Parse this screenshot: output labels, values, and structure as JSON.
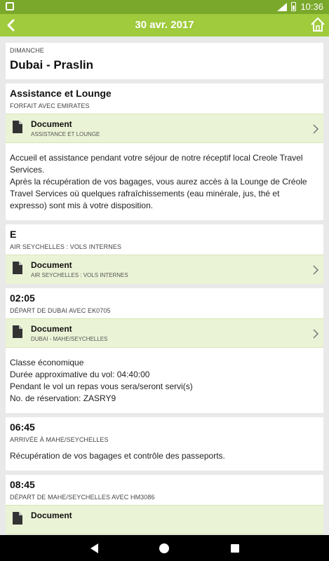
{
  "status_bar": {
    "time": "10:36",
    "signal": "4G",
    "battery": "charging"
  },
  "app_bar": {
    "title": "30 avr. 2017",
    "back_icon": "chevron-left-icon",
    "home_icon": "home-icon"
  },
  "day_card": {
    "day_label": "DIMANCHE",
    "route": "Dubai - Praslin"
  },
  "sections": [
    {
      "title": "Assistance et Lounge",
      "subtitle": "FORFAIT AVEC EMIRATES",
      "document": {
        "title": "Document",
        "subtitle": "ASSISTANCE ET LOUNGE"
      },
      "lines": [
        "Accueil et assistance pendant votre séjour de notre réceptif local Creole Travel",
        "Services.",
        "Après la récupération de vos bagages, vous aurez accès à la Lounge de Créole",
        "Travel Services où quelques rafraîchissements (eau minérale, jus, thé et",
        "expresso) sont mis à votre disposition."
      ]
    },
    {
      "title": "E",
      "subtitle": "AIR SEYCHELLES : VOLS INTERNES",
      "document": {
        "title": "Document",
        "subtitle": "AIR SEYCHELLES : VOLS INTERNES"
      },
      "lines": []
    },
    {
      "title": "02:05",
      "subtitle": "DÉPART DE DUBAI AVEC EK0705",
      "document": {
        "title": "Document",
        "subtitle": "DUBAI - MAHE/SEYCHELLES"
      },
      "lines": [
        "Classe économique",
        "Durée approximative du vol: 04:40:00",
        "Pendant le vol un repas vous sera/seront servi(s)",
        "No. de réservation: ZASRY9"
      ]
    },
    {
      "title": "06:45",
      "subtitle": "ARRIVÉE À MAHE/SEYCHELLES",
      "document": null,
      "lines": [
        "Récupération de vos bagages et contrôle des passeports."
      ]
    },
    {
      "title": "08:45",
      "subtitle": "DÉPART DE MAHE/SEYCHELLES AVEC HM3086",
      "document": {
        "title": "Document",
        "subtitle": ""
      },
      "lines": []
    }
  ],
  "colors": {
    "status_bar": "#7aa82a",
    "app_bar": "#9fcb3c",
    "doc_row": "#ebf3d6",
    "background": "#e9e9e9"
  },
  "nav_bar": {
    "back_icon": "triangle-back-icon",
    "home_icon": "circle-home-icon",
    "recents_icon": "square-recents-icon"
  }
}
